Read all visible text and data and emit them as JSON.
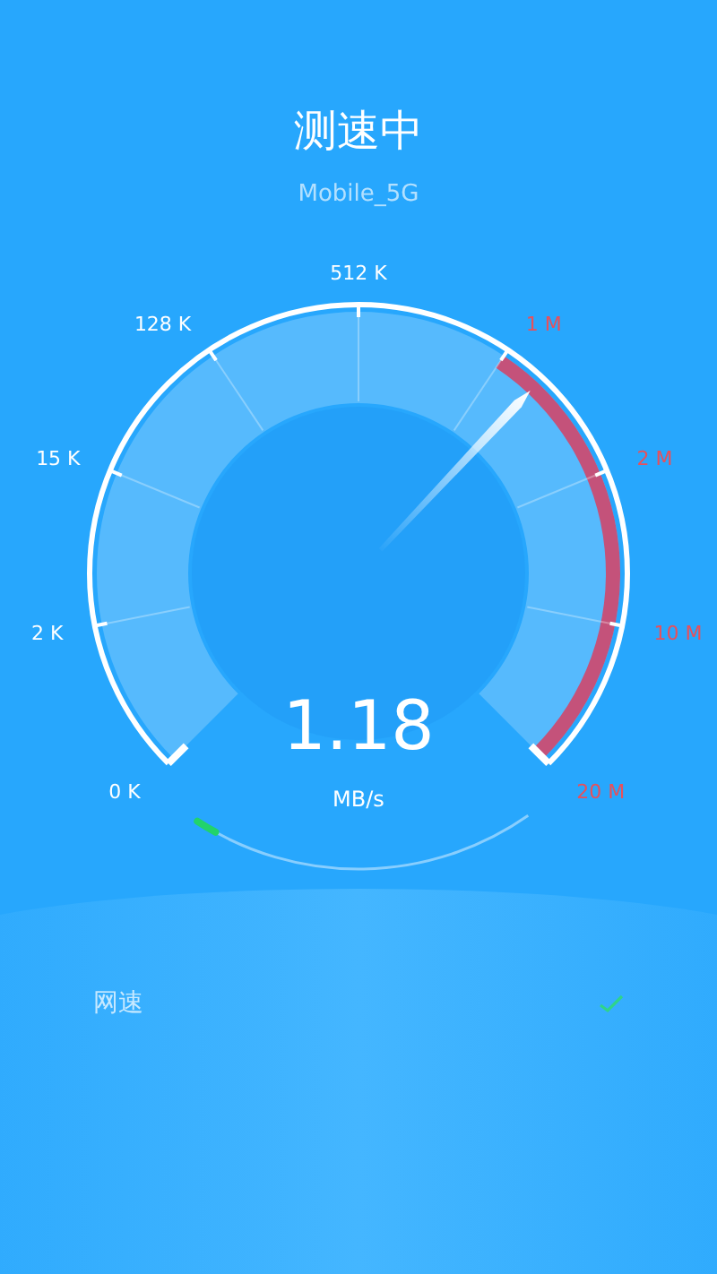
{
  "header": {
    "title": "测速中",
    "network": "Mobile_5G"
  },
  "gauge": {
    "ticks": [
      {
        "label": "0 K",
        "color": "#ffffff"
      },
      {
        "label": "2 K",
        "color": "#ffffff"
      },
      {
        "label": "15 K",
        "color": "#ffffff"
      },
      {
        "label": "128 K",
        "color": "#ffffff"
      },
      {
        "label": "512 K",
        "color": "#ffffff"
      },
      {
        "label": "1 M",
        "color": "#e8505b"
      },
      {
        "label": "2 M",
        "color": "#e8505b"
      },
      {
        "label": "10 M",
        "color": "#e8505b"
      },
      {
        "label": "20 M",
        "color": "#e8505b"
      }
    ],
    "level": 0.66,
    "value": "1.18",
    "unit": "MB/s"
  },
  "progress": {
    "level": 0.06
  },
  "results": [
    {
      "label": "网速",
      "checked": true
    }
  ]
}
